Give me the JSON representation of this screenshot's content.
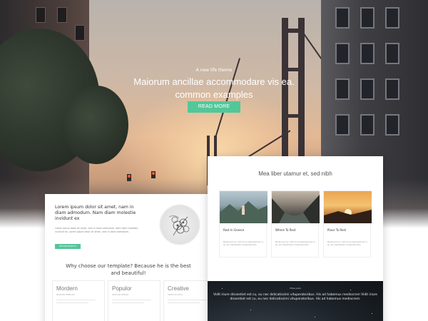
{
  "hero": {
    "tagline": "A new life theme",
    "title": "Maiorum ancillae accommodare vis ea. common examples",
    "button_label": "READ MORE"
  },
  "left_card": {
    "heading": "Lorem ipsum dolor sit amet, nam in diam admodum. Nam diam molestie invidunt ex",
    "body": "Lorem ipsum dolor sit amet, nam in diam admodum. Nam diam molestie invidunt ex. Lorem ipsum dolor sit amet, nam in diam admodum.",
    "button_label": "EXPLORE MORE ITS",
    "why_heading": "Why choose our template? Because he is the best and beautiful!",
    "features": [
      {
        "title": "Mordern",
        "subtitle": "MODERN TEMPLATE"
      },
      {
        "title": "Populor",
        "subtitle": "POPULAR DESIGN"
      },
      {
        "title": "Creative",
        "subtitle": "CREATIVE IDEAS"
      }
    ]
  },
  "right_card": {
    "title": "Mea liber utamur et, sed nibh",
    "destinations": [
      {
        "title": "Rest In Greece",
        "body": "Mediocrem an. Vidit iriure dissentiet est cu, eu nec delicatissimi vituperatoribus."
      },
      {
        "title": "Where To Rest",
        "body": "Mediocrem an. Vidit iriure dissentiet est cu, eu nec delicatissimi vituperatoribus."
      },
      {
        "title": "Place To Rest",
        "body": "Mediocrem an. Vidit iriure dissentiet est cu, eu nec delicatissimi vituperatoribus."
      }
    ],
    "dark_small": "Vitae justo",
    "dark_text": "Vidit iriure dissentiet est cu, eu nec delicatissimi vituperatoribus. His ad habemus mediocrem Vidit iriure dissentiet est cu, eu nec delicatissimi vituperatoribus. His ad habemus mediocrem."
  },
  "colors": {
    "accent": "#52c79a"
  },
  "icons": {
    "flower": "flower-illustration-icon"
  }
}
